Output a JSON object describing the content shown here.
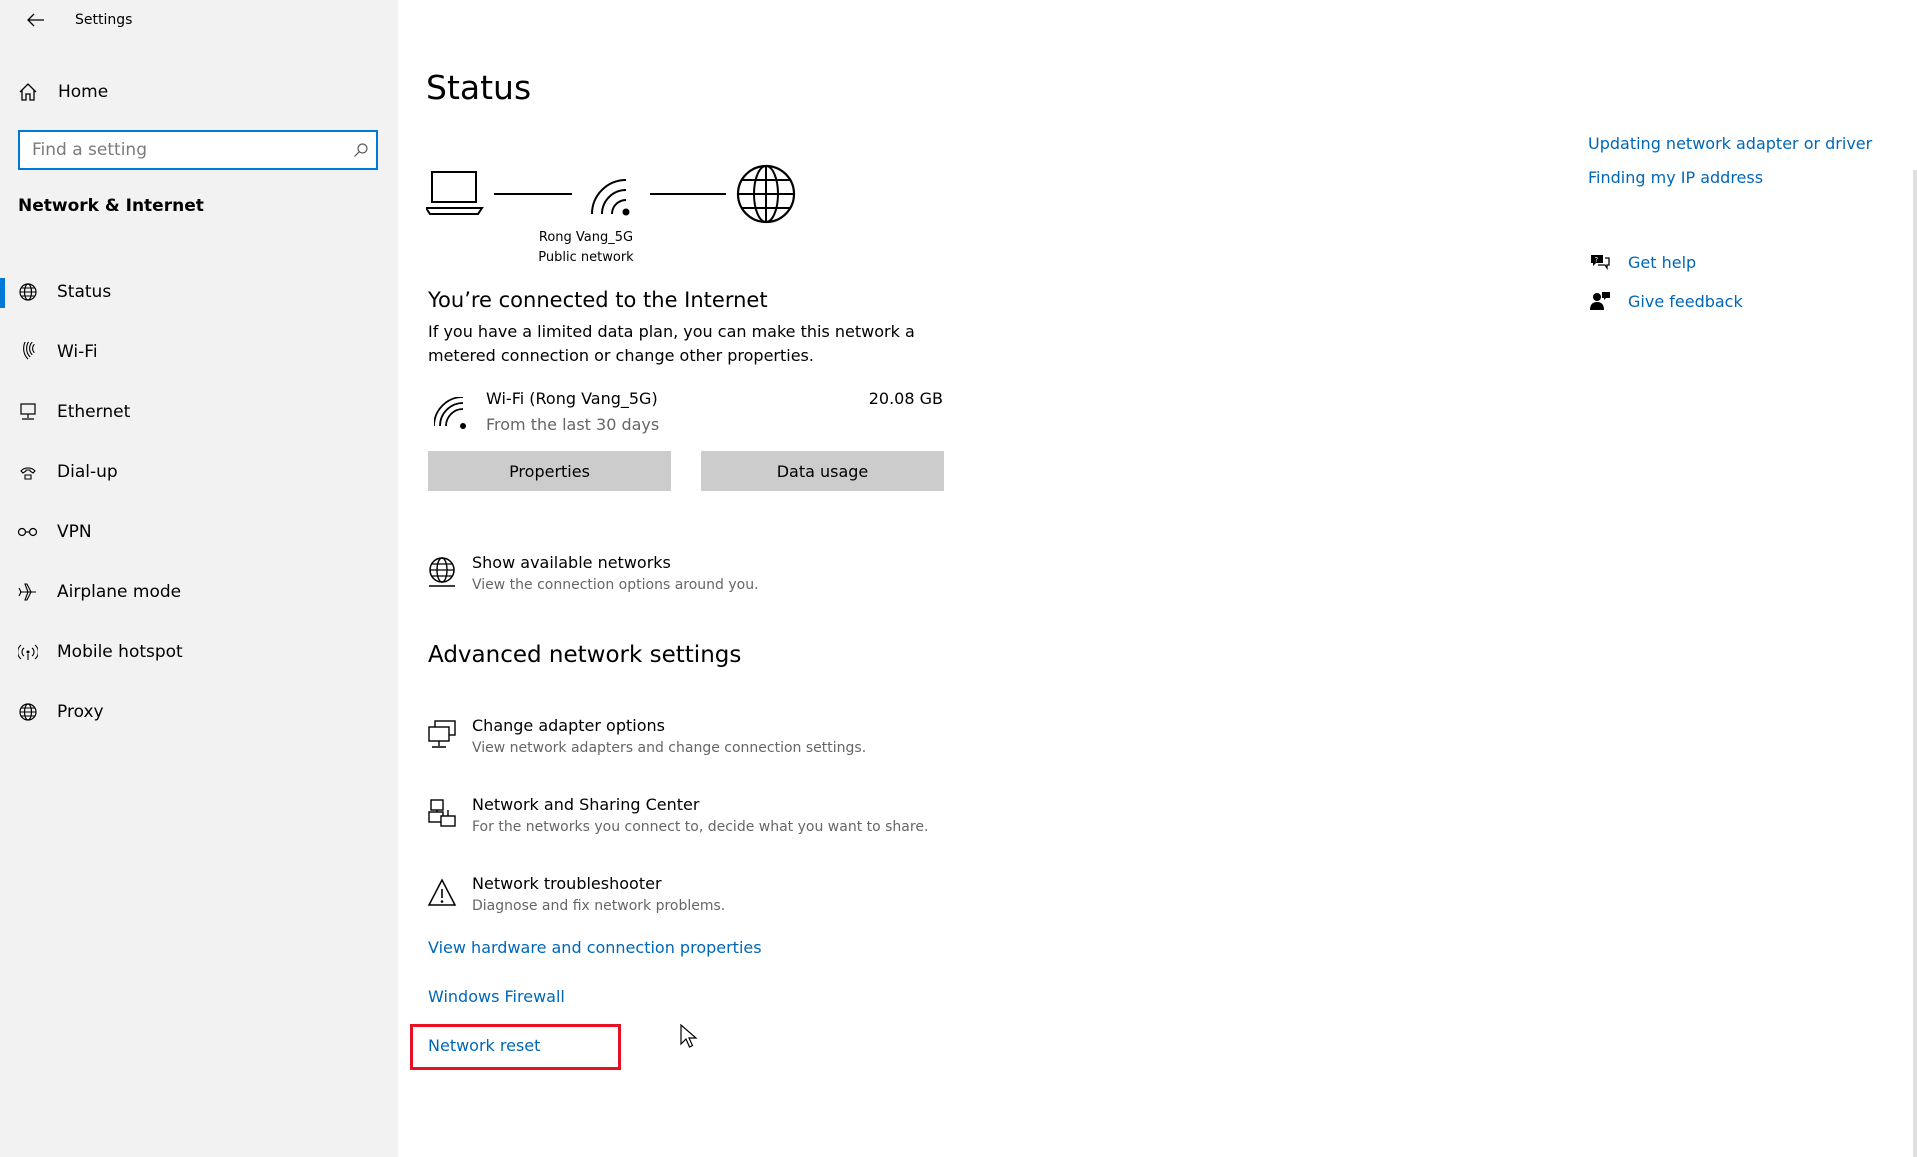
{
  "window": {
    "title": "Settings",
    "minimize_glyph": "–",
    "close_glyph": "✕"
  },
  "sidebar": {
    "home_label": "Home",
    "search_placeholder": "Find a setting",
    "section_title": "Network & Internet",
    "items": [
      {
        "label": "Status",
        "icon": "globe-status-icon",
        "active": true
      },
      {
        "label": "Wi-Fi",
        "icon": "wifi-icon",
        "active": false
      },
      {
        "label": "Ethernet",
        "icon": "ethernet-icon",
        "active": false
      },
      {
        "label": "Dial-up",
        "icon": "dialup-icon",
        "active": false
      },
      {
        "label": "VPN",
        "icon": "vpn-icon",
        "active": false
      },
      {
        "label": "Airplane mode",
        "icon": "airplane-icon",
        "active": false
      },
      {
        "label": "Mobile hotspot",
        "icon": "hotspot-icon",
        "active": false
      },
      {
        "label": "Proxy",
        "icon": "globe-icon",
        "active": false
      }
    ]
  },
  "main": {
    "title": "Status",
    "network": {
      "name": "Rong Vang_5G",
      "type": "Public network"
    },
    "connected_title": "You’re connected to the Internet",
    "connected_desc": "If you have a limited data plan, you can make this network a metered connection or change other properties.",
    "usage": {
      "name": "Wi-Fi (Rong Vang_5G)",
      "period": "From the last 30 days",
      "amount": "20.08 GB"
    },
    "buttons": {
      "properties": "Properties",
      "data_usage": "Data usage"
    },
    "show_networks": {
      "title": "Show available networks",
      "desc": "View the connection options around you."
    },
    "advanced_title": "Advanced network settings",
    "advanced": [
      {
        "title": "Change adapter options",
        "desc": "View network adapters and change connection settings."
      },
      {
        "title": "Network and Sharing Center",
        "desc": "For the networks you connect to, decide what you want to share."
      },
      {
        "title": "Network troubleshooter",
        "desc": "Diagnose and fix network problems."
      }
    ],
    "links": {
      "hardware": "View hardware and connection properties",
      "firewall": "Windows Firewall",
      "reset": "Network reset"
    }
  },
  "right": {
    "related": [
      "Updating network adapter or driver",
      "Finding my IP address"
    ],
    "get_help": "Get help",
    "give_feedback": "Give feedback"
  },
  "colors": {
    "accent": "#0078d7",
    "link": "#0067b8",
    "highlight": "#e81123",
    "sidebar_bg": "#f2f2f2"
  }
}
